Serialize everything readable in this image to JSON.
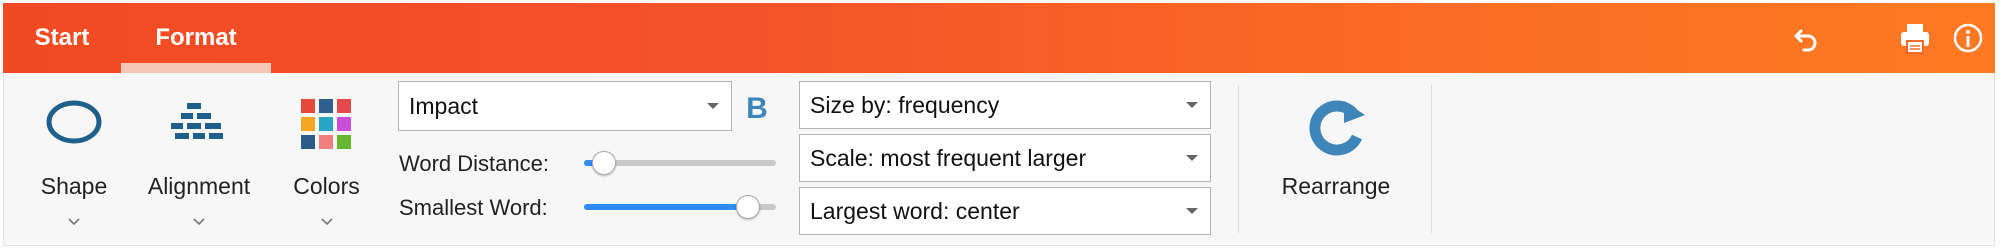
{
  "tabs": [
    {
      "label": "Start",
      "active": false
    },
    {
      "label": "Format",
      "active": true
    }
  ],
  "topbar": {
    "icons": [
      "undo-icon",
      "print-icon",
      "info-icon"
    ],
    "gradient_start": "#f04a22",
    "gradient_end": "#fd7a22"
  },
  "toolbar": {
    "shape_label": "Shape",
    "alignment_label": "Alignment",
    "colors_label": "Colors",
    "font_value": "Impact",
    "bold_label": "B",
    "word_distance_label": "Word Distance:",
    "word_distance_value": 0.1,
    "smallest_word_label": "Smallest Word:",
    "smallest_word_value": 0.85,
    "size_by_value": "Size by: frequency",
    "scale_value": "Scale: most frequent larger",
    "largest_word_value": "Largest word: center",
    "rearrange_label": "Rearrange"
  },
  "colors": {
    "accent_blue": "#1f5f8b",
    "bold_blue": "#3e86b9",
    "slider_fill": "#2f8cf0",
    "palette": [
      "#e8493a",
      "#2e5f8f",
      "#e5484d",
      "#f6a623",
      "#2aa6c4",
      "#c84fd8",
      "#2b5c8a",
      "#f08080",
      "#67b52e"
    ]
  }
}
